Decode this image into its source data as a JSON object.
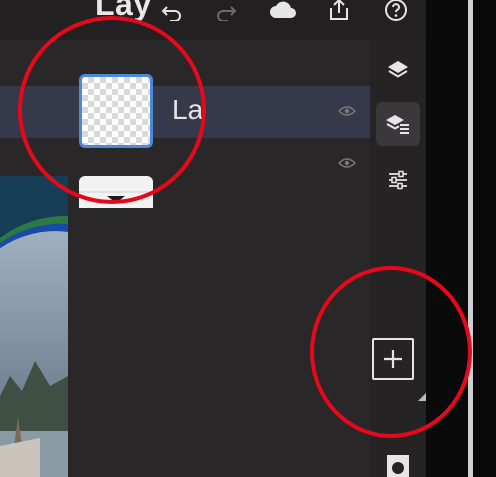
{
  "app": {
    "panel_title": "Lay",
    "layer_name_visible": "La"
  },
  "icons": {
    "undo": "undo-icon",
    "redo": "redo-icon",
    "cloud": "cloud-icon",
    "share": "share-icon",
    "help": "help-icon",
    "layers": "layers-icon",
    "layer_properties": "layer-properties-icon",
    "adjustments": "adjustments-icon",
    "visibility": "eye-icon",
    "add_layer": "add-layer-icon",
    "mask": "mask-icon"
  },
  "colors": {
    "highlight_circle": "#e5091b",
    "selection_row": "#35394a",
    "thumb_border": "#4b8ad8"
  }
}
